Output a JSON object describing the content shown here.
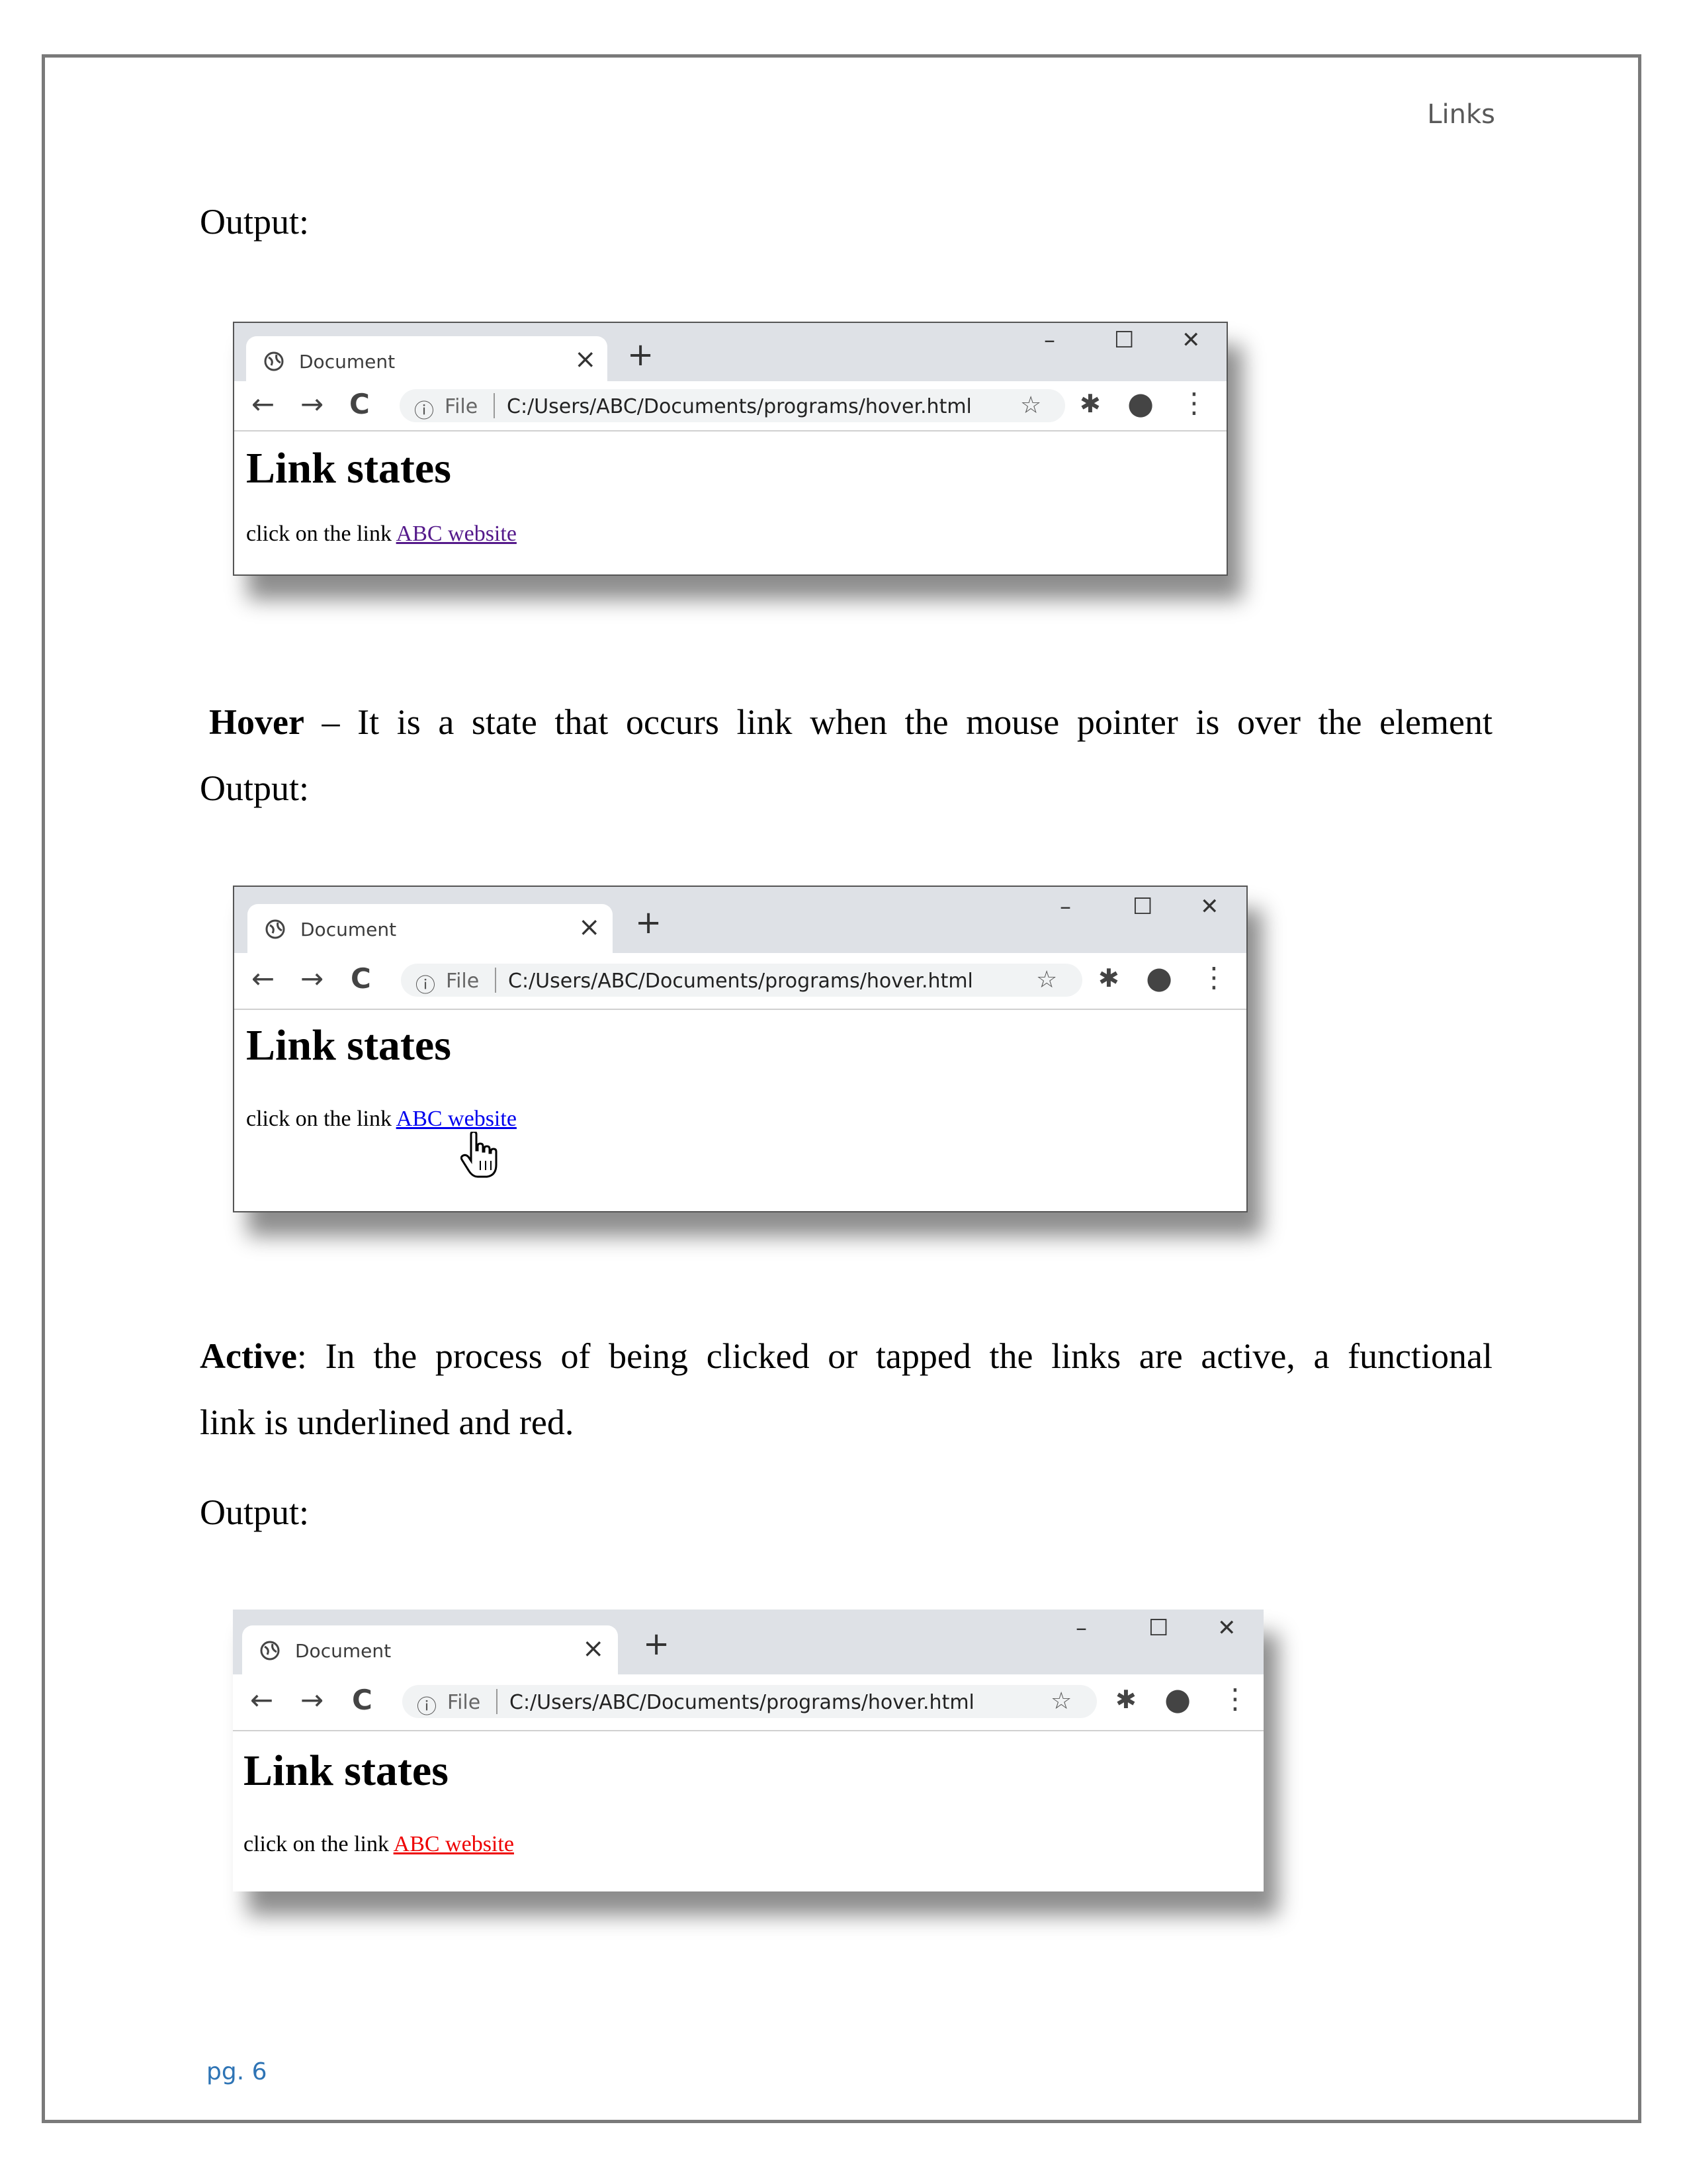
{
  "header": {
    "title": "Links"
  },
  "sections": {
    "output_label": "Output:",
    "hover": {
      "term": "Hover",
      "text": " – It is a state that occurs link when the mouse pointer is over the element"
    },
    "active": {
      "term": "Active",
      "text_line1": ": In the process of being clicked or tapped the links are active, a functional",
      "text_line2": "link is underlined and red."
    }
  },
  "browser": {
    "tab_title": "Document",
    "tab_close": "×",
    "new_tab": "+",
    "minimize": "–",
    "maximize": "☐",
    "close": "✕",
    "back": "←",
    "forward": "→",
    "reload": "C",
    "info": "ⓘ",
    "file_label": "File",
    "url": "C:/Users/ABC/Documents/programs/hover.html",
    "star": "☆",
    "extensions": "✱",
    "profile": "●",
    "menu": "⋮",
    "heading": "Link states",
    "body_text": "click on the link",
    "link_text": "ABC website"
  },
  "link_colors": {
    "visited": "#551a8b",
    "hover": "#0000ee",
    "active": "#ee0000"
  },
  "footer": {
    "page": "pg. 6"
  }
}
